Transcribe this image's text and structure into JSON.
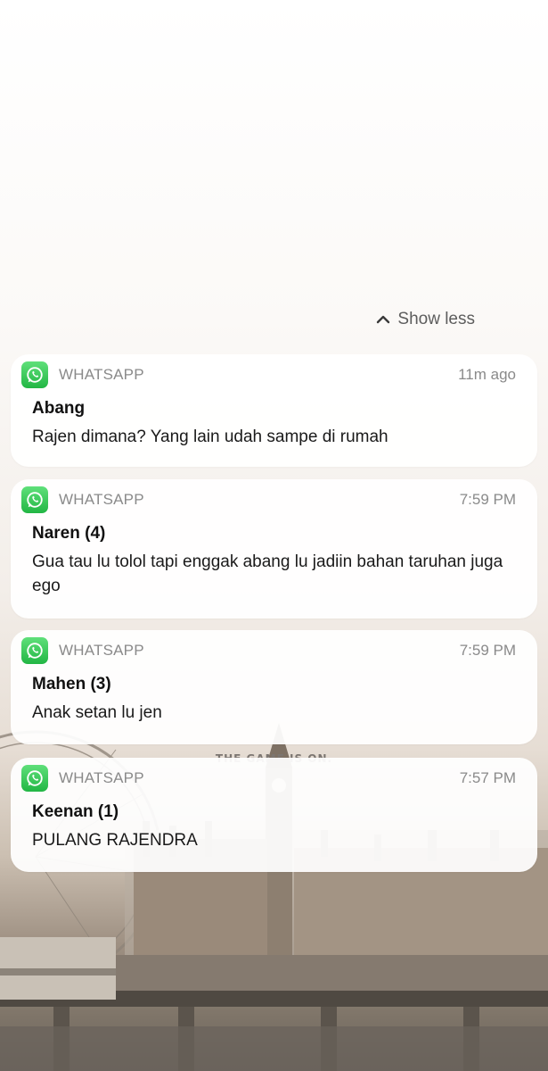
{
  "wallpaper": {
    "tagline": "THE GAME IS ON."
  },
  "show_less": {
    "label": "Show less",
    "icon": "chevron-up-icon"
  },
  "notifications": [
    {
      "app": "WHATSAPP",
      "time": "11m ago",
      "sender": "Abang",
      "message": "Rajen dimana? Yang lain udah sampe di rumah"
    },
    {
      "app": "WHATSAPP",
      "time": "7:59 PM",
      "sender": "Naren (4)",
      "message": "Gua tau lu tolol tapi enggak abang lu jadiin bahan taruhan juga ego"
    },
    {
      "app": "WHATSAPP",
      "time": "7:59 PM",
      "sender": "Mahen (3)",
      "message": "Anak setan lu jen"
    },
    {
      "app": "WHATSAPP",
      "time": "7:57 PM",
      "sender": "Keenan (1)",
      "message": "PULANG RAJENDRA"
    }
  ],
  "colors": {
    "whatsapp_green": "#25D366",
    "meta_text": "#8a8a8a"
  }
}
